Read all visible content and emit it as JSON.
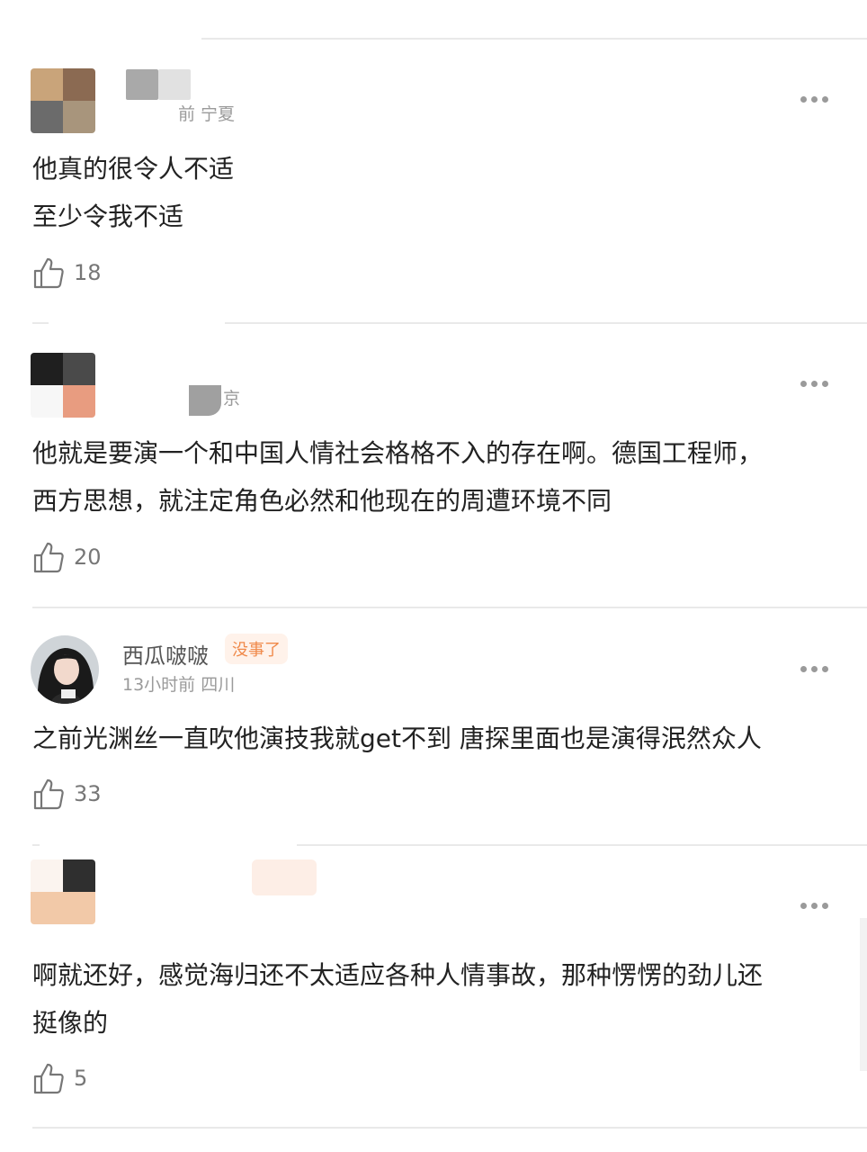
{
  "comments": [
    {
      "username": "",
      "meta": "前 宁夏",
      "text_lines": [
        "他真的很令人不适",
        "至少令我不适"
      ],
      "likes": "18",
      "like_icon": "thumbs-up-icon",
      "more_icon": "more-icon"
    },
    {
      "username": "",
      "meta": "京",
      "text_lines": [
        "他就是要演一个和中国人情社会格格不入的存在啊。德国工程师，",
        "西方思想，就注定角色必然和他现在的周遭环境不同"
      ],
      "likes": "20",
      "like_icon": "thumbs-up-icon",
      "more_icon": "more-icon"
    },
    {
      "username": "西瓜啵啵",
      "badge": "没事了",
      "meta": "13小时前 四川",
      "text_lines": [
        "之前光渊丝一直吹他演技我就get不到 唐探里面也是演得泯然众人"
      ],
      "likes": "33",
      "like_icon": "thumbs-up-icon",
      "more_icon": "more-icon"
    },
    {
      "username": "",
      "meta": "",
      "text_lines": [
        "啊就还好，感觉海归还不太适应各种人情事故，那种愣愣的劲儿还",
        "挺像的"
      ],
      "likes": "5",
      "like_icon": "thumbs-up-icon",
      "more_icon": "more-icon"
    }
  ],
  "colors": {
    "text": "#222222",
    "meta": "#9a9a9a",
    "badge": "#f08a4b",
    "divider": "#e9e9e9"
  }
}
